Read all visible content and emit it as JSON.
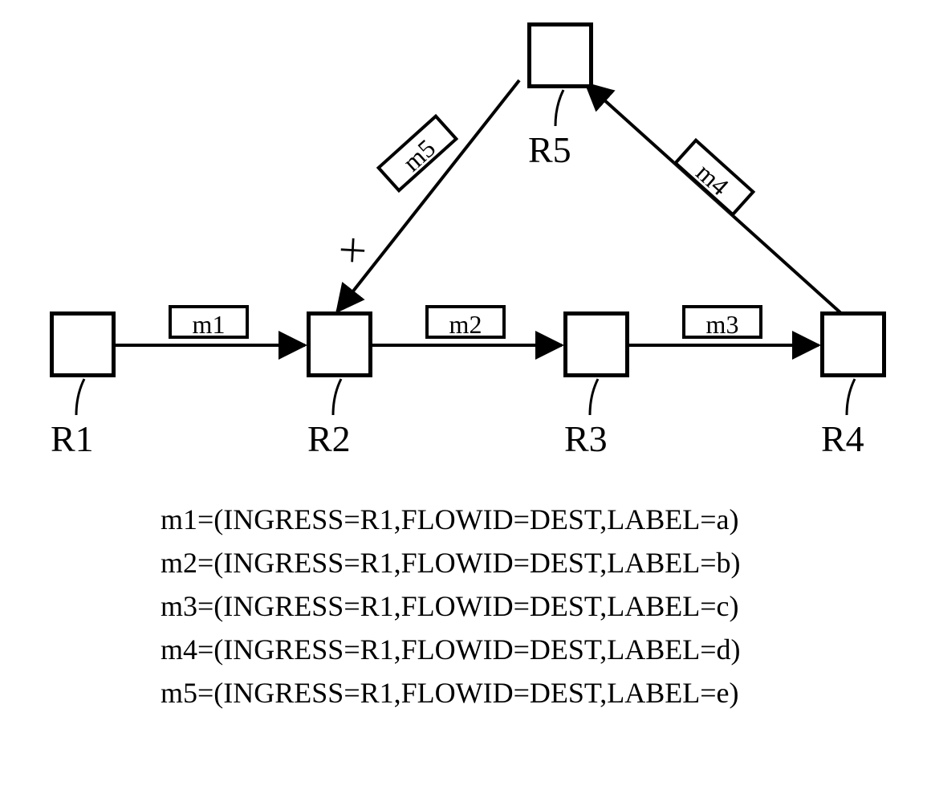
{
  "nodes": {
    "R1": "R1",
    "R2": "R2",
    "R3": "R3",
    "R4": "R4",
    "R5": "R5"
  },
  "msgs": {
    "m1": "m1",
    "m2": "m2",
    "m3": "m3",
    "m4": "m4",
    "m5": "m5"
  },
  "defs": {
    "m1": "m1=(INGRESS=R1,FLOWID=DEST,LABEL=a)",
    "m2": "m2=(INGRESS=R1,FLOWID=DEST,LABEL=b)",
    "m3": "m3=(INGRESS=R1,FLOWID=DEST,LABEL=c)",
    "m4": "m4=(INGRESS=R1,FLOWID=DEST,LABEL=d)",
    "m5": "m5=(INGRESS=R1,FLOWID=DEST,LABEL=e)"
  },
  "chart_data": {
    "type": "network-diagram",
    "nodes": [
      "R1",
      "R2",
      "R3",
      "R4",
      "R5"
    ],
    "edges": [
      {
        "from": "R1",
        "to": "R2",
        "label": "m1"
      },
      {
        "from": "R2",
        "to": "R3",
        "label": "m2"
      },
      {
        "from": "R3",
        "to": "R4",
        "label": "m3"
      },
      {
        "from": "R4",
        "to": "R5",
        "label": "m4"
      },
      {
        "from": "R5",
        "to": "R2",
        "label": "m5",
        "failed": true
      }
    ],
    "messages": [
      {
        "id": "m1",
        "INGRESS": "R1",
        "FLOWID": "DEST",
        "LABEL": "a"
      },
      {
        "id": "m2",
        "INGRESS": "R1",
        "FLOWID": "DEST",
        "LABEL": "b"
      },
      {
        "id": "m3",
        "INGRESS": "R1",
        "FLOWID": "DEST",
        "LABEL": "c"
      },
      {
        "id": "m4",
        "INGRESS": "R1",
        "FLOWID": "DEST",
        "LABEL": "d"
      },
      {
        "id": "m5",
        "INGRESS": "R1",
        "FLOWID": "DEST",
        "LABEL": "e"
      }
    ]
  }
}
